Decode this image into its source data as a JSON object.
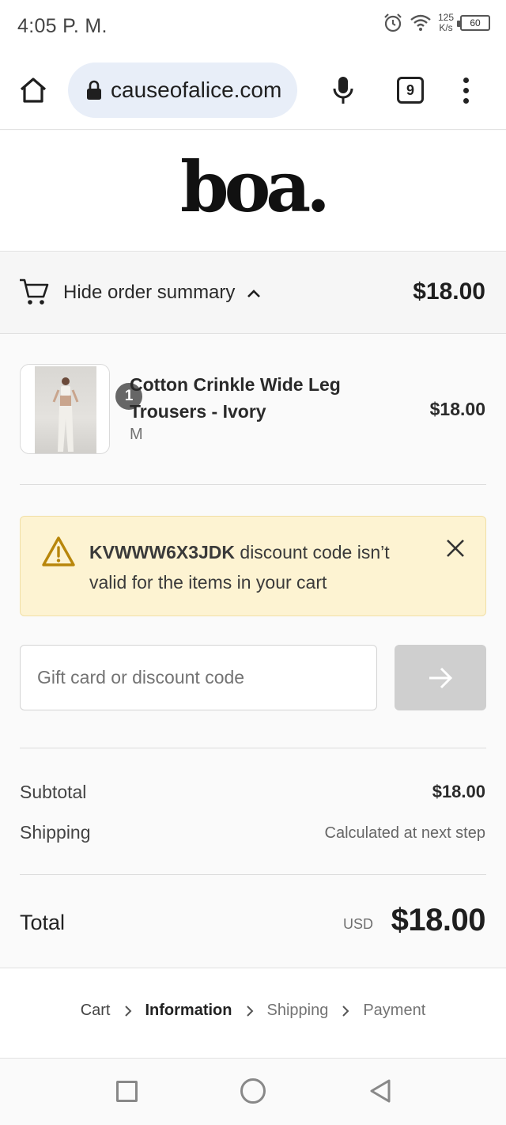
{
  "status_bar": {
    "time": "4:05 P. M.",
    "net_speed_value": "125",
    "net_speed_unit": "K/s",
    "battery": "60",
    "icons": [
      "alarm-icon",
      "wifi-icon",
      "battery-icon"
    ]
  },
  "browser": {
    "url": "causeofalice.com",
    "tab_count": "9",
    "icons": [
      "home-icon",
      "lock-icon",
      "mic-icon",
      "tabs-icon",
      "more-vert-icon"
    ]
  },
  "brand": {
    "logo_text": "boa."
  },
  "summary": {
    "toggle_label": "Hide order summary",
    "total": "$18.00"
  },
  "product": {
    "quantity": "1",
    "name": "Cotton Crinkle Wide Leg Trousers - Ivory",
    "variant": "M",
    "price": "$18.00"
  },
  "alert": {
    "code": "KVWWW6X3JDK",
    "message": " discount code isn’t valid for the items in your cart",
    "color": "#fdf3d2"
  },
  "discount": {
    "placeholder": "Gift card or discount code"
  },
  "totals": {
    "subtotal_label": "Subtotal",
    "subtotal_value": "$18.00",
    "shipping_label": "Shipping",
    "shipping_value": "Calculated at next step",
    "total_label": "Total",
    "total_currency": "USD",
    "total_value": "$18.00"
  },
  "breadcrumb": {
    "cart": "Cart",
    "information": "Information",
    "shipping": "Shipping",
    "payment": "Payment"
  }
}
